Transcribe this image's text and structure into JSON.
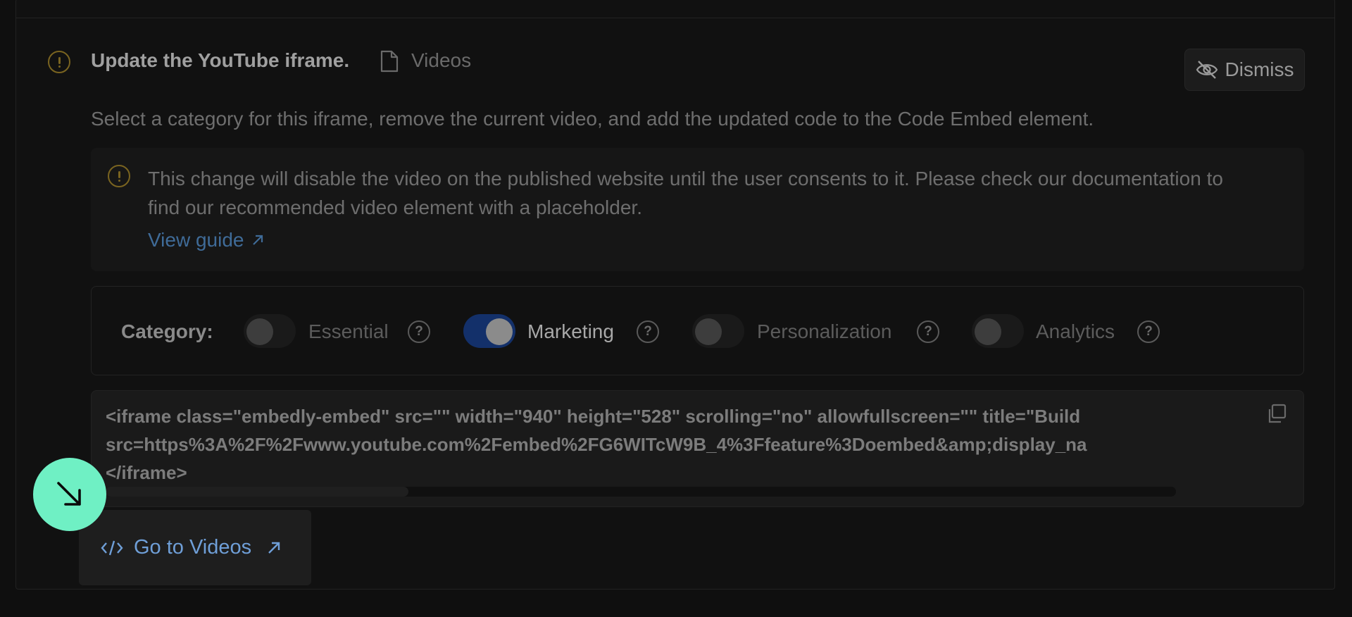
{
  "issue": {
    "title": "Update the YouTube iframe.",
    "page_label": "Videos",
    "description": "Select a category for this iframe, remove the current video, and add the updated code to the Code Embed element.",
    "dismiss_label": "Dismiss"
  },
  "notice": {
    "text": "This change will disable the video on the published website until the user consents to it. Please check our documentation to find our recommended video element with a placeholder.",
    "link_label": "View guide"
  },
  "category": {
    "label": "Category:",
    "options": [
      {
        "label": "Essential",
        "enabled": false,
        "help": "?"
      },
      {
        "label": "Marketing",
        "enabled": true,
        "help": "?"
      },
      {
        "label": "Personalization",
        "enabled": false,
        "help": "?"
      },
      {
        "label": "Analytics",
        "enabled": false,
        "help": "?"
      }
    ]
  },
  "code": {
    "lines": [
      "<iframe class=\"embedly-embed\" src=\"\" width=\"940\" height=\"528\" scrolling=\"no\" allowfullscreen=\"\" title=\"Build",
      "src=https%3A%2F%2Fwww.youtube.com%2Fembed%2FG6WITcW9B_4%3Ffeature%3Doembed&amp;display_na",
      "</iframe>"
    ],
    "scroll_position": 0
  },
  "footer": {
    "goto_label": "Go to Videos"
  },
  "colors": {
    "warning": "#7a6420",
    "link": "#3f6b98",
    "toggle_on": "#13306a",
    "fab": "#6ff0c4"
  }
}
